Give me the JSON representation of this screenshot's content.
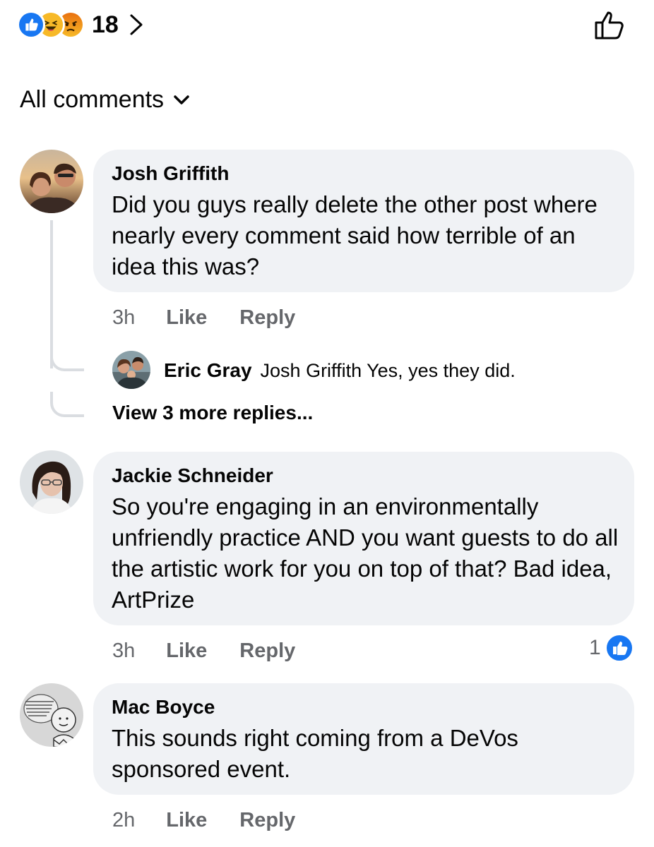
{
  "reactions": {
    "icons": [
      "like-icon",
      "haha-icon",
      "angry-icon"
    ],
    "count": "18"
  },
  "sort": {
    "label": "All comments"
  },
  "comments": [
    {
      "author": "Josh Griffith",
      "text": "Did you guys really delete the other post where nearly every comment said how terrible of an idea this was?",
      "time": "3h",
      "like_label": "Like",
      "reply_label": "Reply",
      "replies": [
        {
          "author": "Eric Gray",
          "text": "Josh Griffith Yes, yes they did."
        }
      ],
      "view_more": "View 3 more replies..."
    },
    {
      "author": "Jackie Schneider",
      "text": "So you're engaging in an environmentally unfriendly practice AND you want guests to do all the artistic work for you on top of that? Bad idea, ArtPrize",
      "time": "3h",
      "like_label": "Like",
      "reply_label": "Reply",
      "like_count": "1"
    },
    {
      "author": "Mac Boyce",
      "text": "This sounds right coming from a DeVos sponsored event.",
      "time": "2h",
      "like_label": "Like",
      "reply_label": "Reply"
    }
  ],
  "colors": {
    "like_blue": "#1877f2",
    "bubble_bg": "#f0f2f5",
    "meta_gray": "#65676b"
  }
}
